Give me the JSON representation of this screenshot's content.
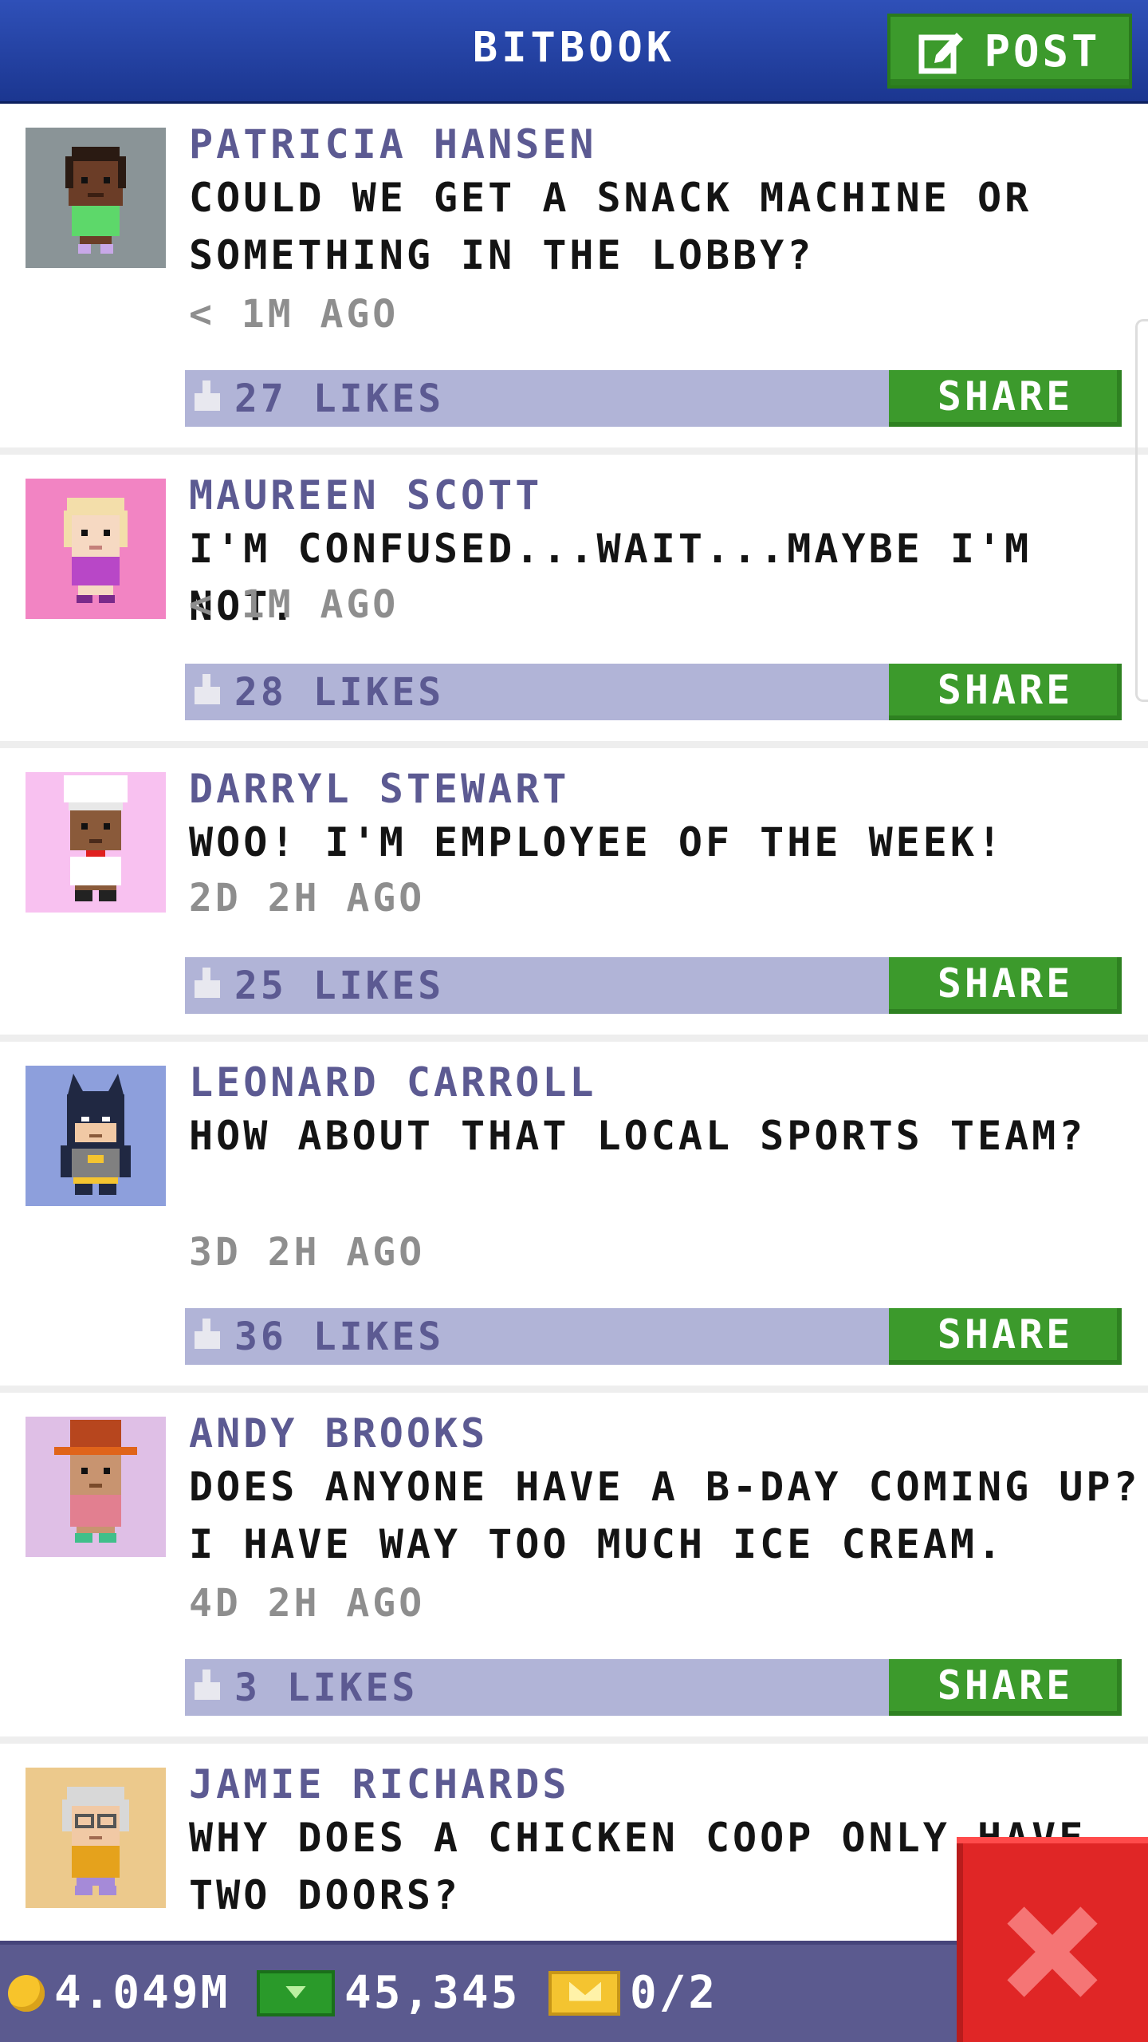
{
  "app": {
    "title": "BITBOOK",
    "post_label": "POST",
    "share_label": "SHARE"
  },
  "posts": [
    {
      "name": "PATRICIA HANSEN",
      "message": "COULD WE GET A SNACK MACHINE OR SOMETHING IN THE LOBBY?",
      "time": "< 1M AGO",
      "likes": "27 LIKES",
      "avatar_bg": "#8a9497",
      "avatar_icon": "person-green-shirt"
    },
    {
      "name": "MAUREEN SCOTT",
      "message": "I'M CONFUSED...WAIT...MAYBE I'M NOT.",
      "time": "< 1M AGO",
      "likes": "28 LIKES",
      "avatar_bg": "#f284c3",
      "avatar_icon": "person-blonde"
    },
    {
      "name": "DARRYL STEWART",
      "message": "WOO! I'M EMPLOYEE OF THE WEEK!",
      "time": "2D 2H AGO",
      "likes": "25 LIKES",
      "avatar_bg": "#f8c1f0",
      "avatar_icon": "person-chef"
    },
    {
      "name": "LEONARD CARROLL",
      "message": "HOW ABOUT THAT LOCAL SPORTS TEAM?",
      "time": "3D 2H AGO",
      "likes": "36 LIKES",
      "avatar_bg": "#8d9fdc",
      "avatar_icon": "person-bat-costume"
    },
    {
      "name": "ANDY BROOKS",
      "message": "DOES ANYONE HAVE A B-DAY COMING UP? I HAVE WAY TOO MUCH ICE CREAM.",
      "time": "4D 2H AGO",
      "likes": "3 LIKES",
      "avatar_bg": "#dfbfe6",
      "avatar_icon": "person-top-hat"
    },
    {
      "name": "JAMIE RICHARDS",
      "message": "WHY DOES A CHICKEN COOP ONLY HAVE TWO DOORS?",
      "time": "",
      "likes": "",
      "avatar_bg": "#ecc98c",
      "avatar_icon": "person-elderly-glasses"
    }
  ],
  "status": {
    "coins": "4.049M",
    "bux": "45,345",
    "tickets": "0/2"
  },
  "colors": {
    "header": "#1f3c98",
    "name": "#5c5a92",
    "likes_bar": "#b1b4d7",
    "share": "#3c9a2c",
    "close": "#e02626"
  }
}
